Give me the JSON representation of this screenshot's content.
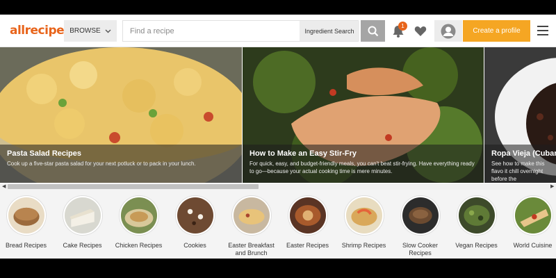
{
  "header": {
    "logo_text": "allrecipes",
    "browse_label": "BROWSE",
    "search_placeholder": "Find a recipe",
    "ingredient_search_label": "Ingredient Search",
    "notification_count": "1",
    "create_profile_label": "Create a profile",
    "brand_color": "#e8641b",
    "accent_color": "#f5a623"
  },
  "carousel": {
    "slides": [
      {
        "title": "Pasta Salad Recipes",
        "description": "Cook up a five-star pasta salad for your next potluck or to pack in your lunch."
      },
      {
        "title": "How to Make an Easy Stir-Fry",
        "description": "For quick, easy, and budget-friendly meals, you can't beat stir-frying. Have everything ready to go—because your actual cooking time is mere minutes."
      },
      {
        "title": "Ropa Vieja (Cuban B",
        "description": "See how to make this flavo it chill overnight before the"
      }
    ]
  },
  "categories": [
    {
      "label": "Bread Recipes"
    },
    {
      "label": "Cake Recipes"
    },
    {
      "label": "Chicken Recipes"
    },
    {
      "label": "Cookies"
    },
    {
      "label": "Easter Breakfast and Brunch"
    },
    {
      "label": "Easter Recipes"
    },
    {
      "label": "Shrimp Recipes"
    },
    {
      "label": "Slow Cooker Recipes"
    },
    {
      "label": "Vegan Recipes"
    },
    {
      "label": "World Cuisine"
    }
  ]
}
